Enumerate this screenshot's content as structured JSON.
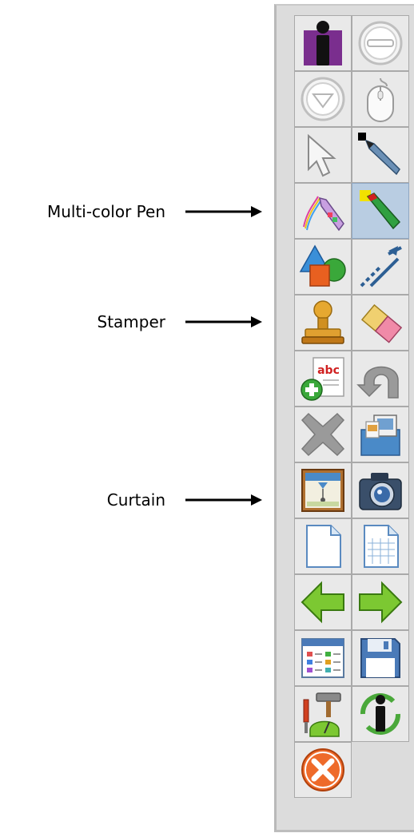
{
  "callouts": {
    "multicolor_pen": "Multi-color Pen",
    "stamper": "Stamper",
    "curtain": "Curtain"
  },
  "toolbar": {
    "buttons": [
      {
        "icon": "info-pillar-icon"
      },
      {
        "icon": "minimize-circle-icon"
      },
      {
        "icon": "collapse-down-circle-icon"
      },
      {
        "icon": "mouse-icon"
      },
      {
        "icon": "select-arrow-icon"
      },
      {
        "icon": "pen-icon"
      },
      {
        "icon": "multicolor-pen-icon"
      },
      {
        "icon": "highlighter-pen-icon",
        "selected": true
      },
      {
        "icon": "shapes-icon"
      },
      {
        "icon": "lines-icon"
      },
      {
        "icon": "stamper-icon"
      },
      {
        "icon": "eraser-icon"
      },
      {
        "icon": "add-text-icon"
      },
      {
        "icon": "undo-icon"
      },
      {
        "icon": "delete-icon"
      },
      {
        "icon": "screen-capture-icon"
      },
      {
        "icon": "curtain-icon"
      },
      {
        "icon": "camera-icon"
      },
      {
        "icon": "blank-page-icon"
      },
      {
        "icon": "grid-page-icon"
      },
      {
        "icon": "previous-page-icon"
      },
      {
        "icon": "next-page-icon"
      },
      {
        "icon": "page-sorter-icon"
      },
      {
        "icon": "save-icon"
      },
      {
        "icon": "tools-icon"
      },
      {
        "icon": "info-refresh-icon"
      },
      {
        "icon": "close-icon"
      }
    ]
  }
}
